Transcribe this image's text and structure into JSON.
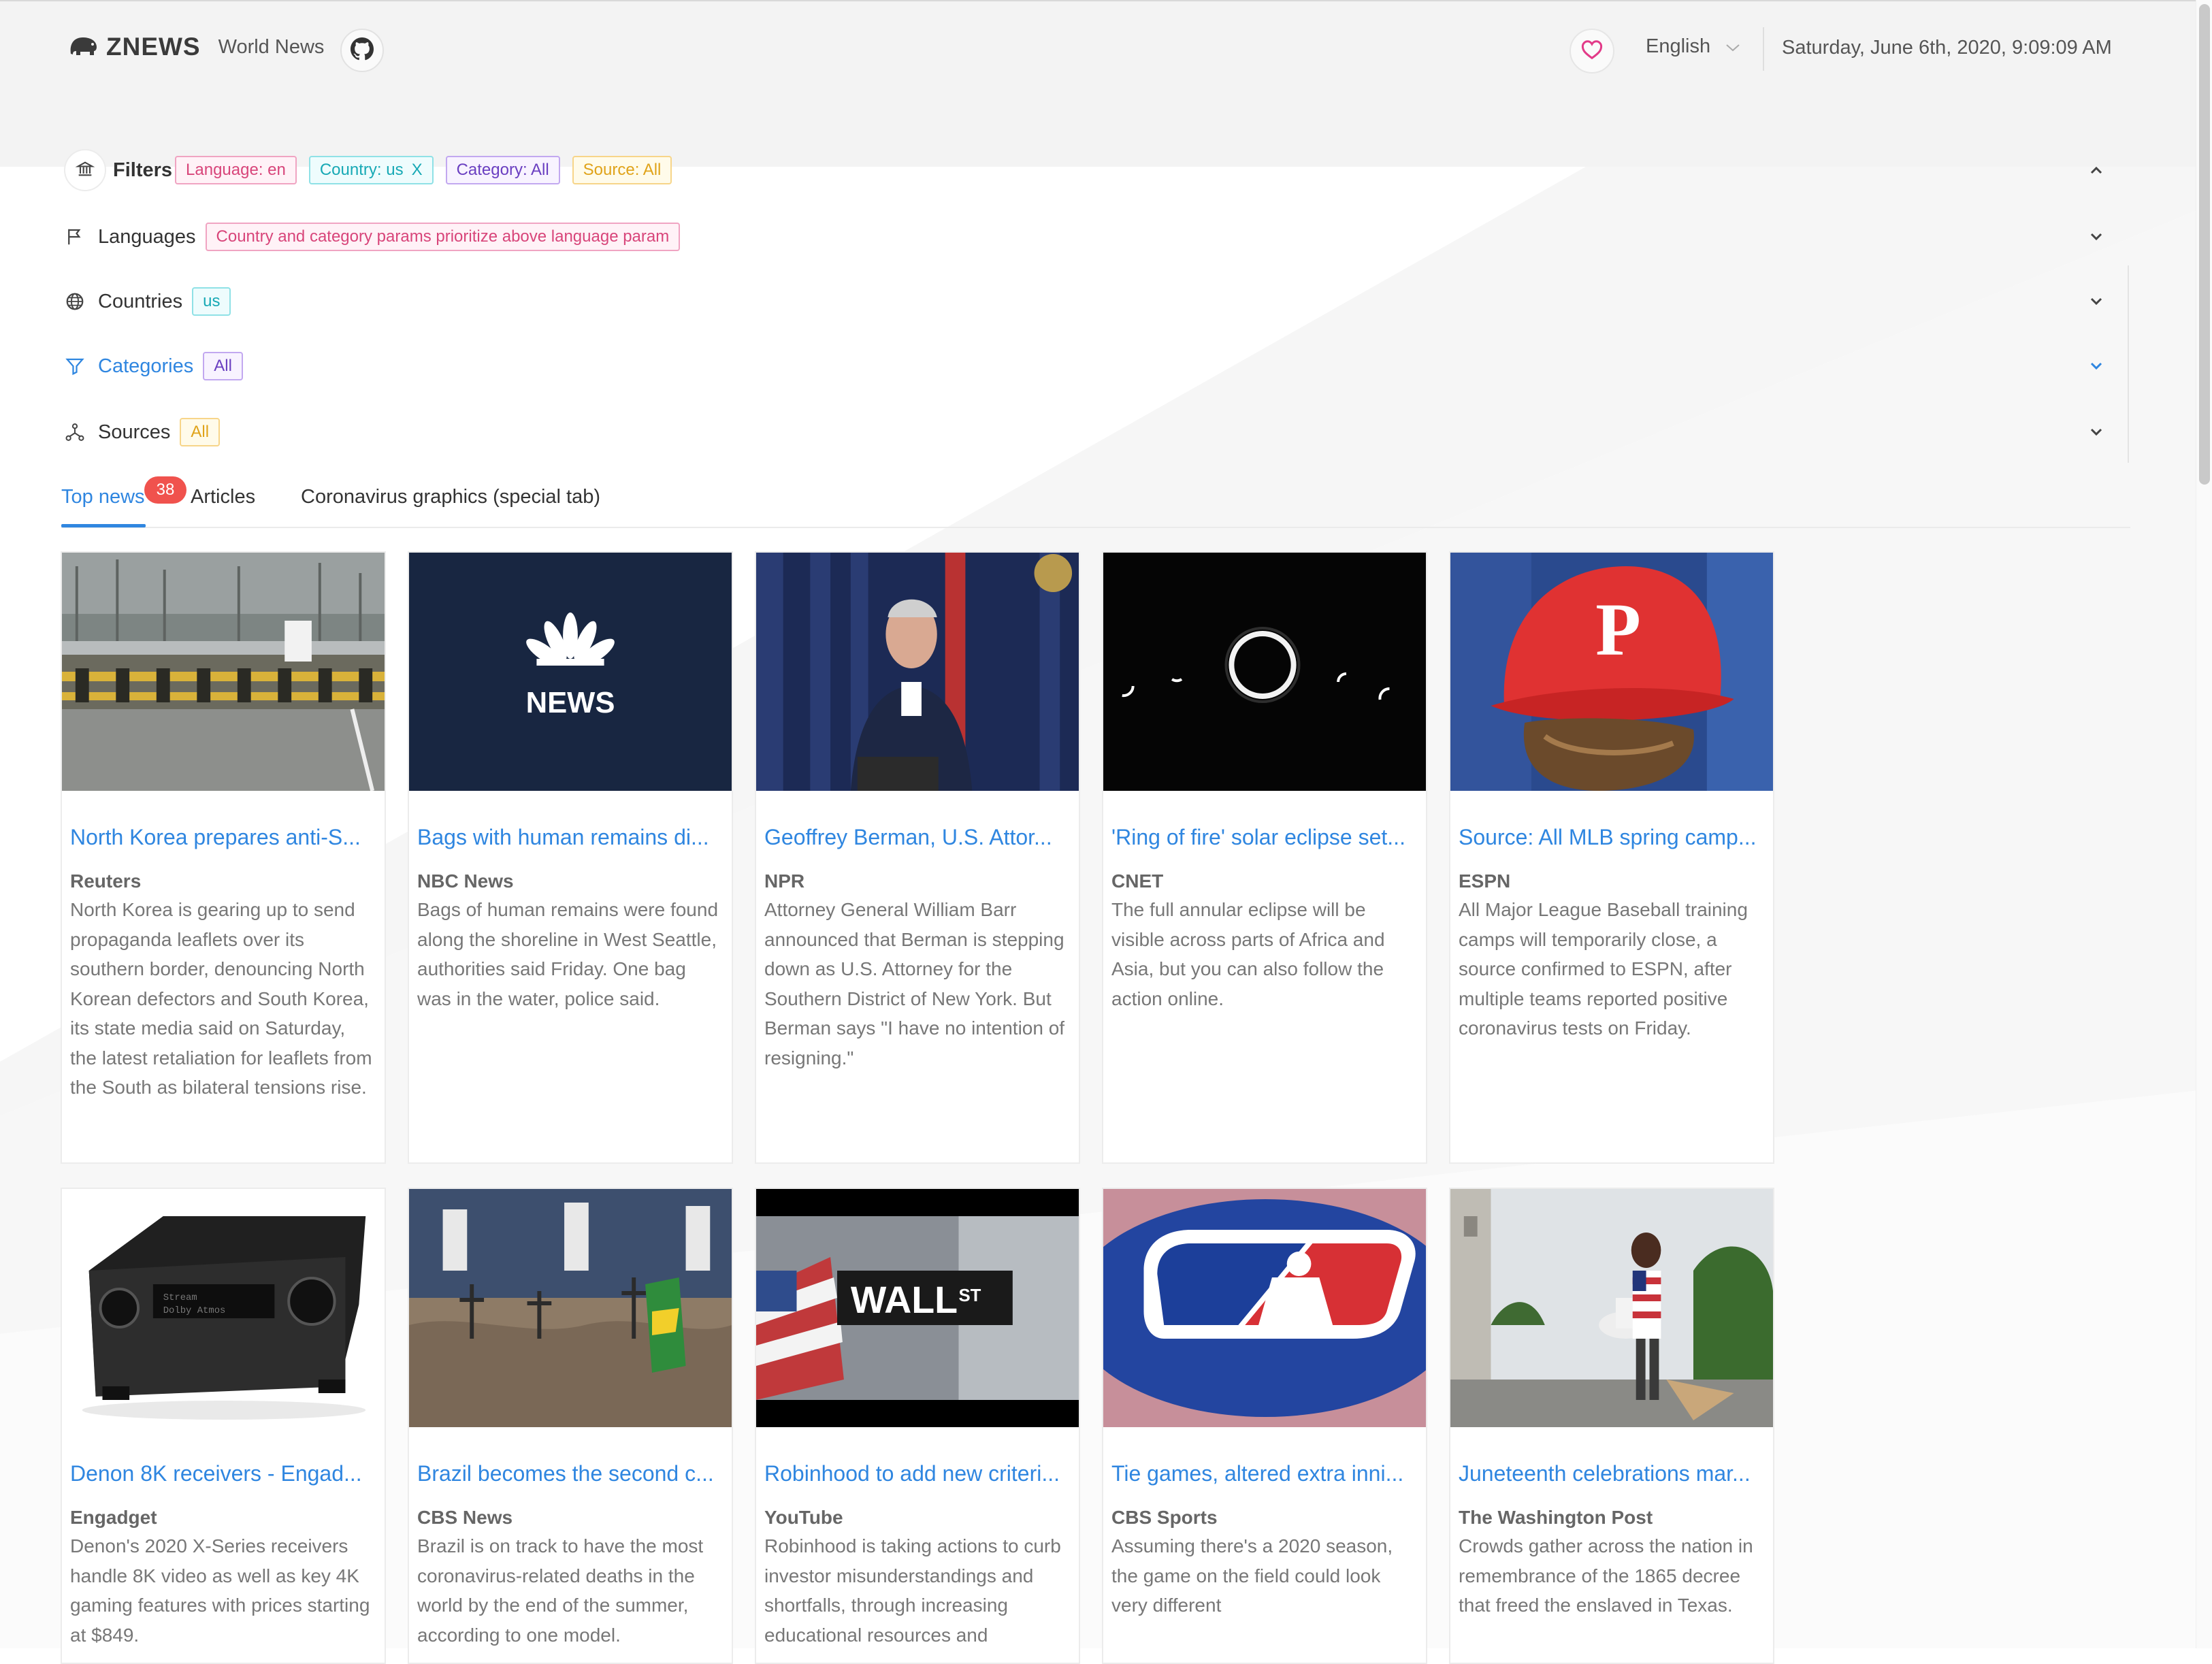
{
  "header": {
    "brand": "ZNEWS",
    "subtitle": "World News",
    "language": "English",
    "datetime": "Saturday, June 6th, 2020, 9:09:09 AM"
  },
  "filters": {
    "title": "Filters",
    "active_tags": [
      {
        "label": "Language: en",
        "color": "#d8457a"
      },
      {
        "label": "Country: us",
        "close": "X",
        "color": "#17a9b5"
      },
      {
        "label": "Category: All",
        "color": "#6a3fc1"
      },
      {
        "label": "Source: All",
        "color": "#e0a31a"
      }
    ],
    "languages": {
      "label": "Languages",
      "note": "Country and category params prioritize above language param"
    },
    "countries": {
      "label": "Countries",
      "tag": "us"
    },
    "categories": {
      "label": "Categories",
      "tag": "All"
    },
    "sources": {
      "label": "Sources",
      "tag": "All"
    }
  },
  "tabs": [
    {
      "label": "Top news",
      "badge": "38",
      "active": true
    },
    {
      "label": "Articles"
    },
    {
      "label": "Coronavirus graphics (special tab)"
    }
  ],
  "cards": [
    {
      "title": "North Korea prepares anti-S...",
      "source": "Reuters",
      "desc": "North Korea is gearing up to send propaganda leaflets over its southern border, denouncing North Korean defectors and South Korea, its state media said on Saturday, the latest retaliation for leaflets from the South as bilateral tensions rise.",
      "image": "border-checkpoint-photo"
    },
    {
      "title": "Bags with human remains di...",
      "source": "NBC News",
      "desc": "Bags of human remains were found along the shoreline in West Seattle, authorities said Friday. One bag was in the water, police said.",
      "image": "nbc-news-logo"
    },
    {
      "title": "Geoffrey Berman, U.S. Attor...",
      "source": "NPR",
      "desc": "Attorney General William Barr announced that Berman is stepping down as U.S. Attorney for the Southern District of New York. But Berman says \"I have no intention of resigning.\"",
      "image": "press-conference-photo"
    },
    {
      "title": "'Ring of fire' solar eclipse set...",
      "source": "CNET",
      "desc": "The full annular eclipse will be visible across parts of Africa and Asia, but you can also follow the action online.",
      "image": "eclipse-photo"
    },
    {
      "title": "Source: All MLB spring camp...",
      "source": "ESPN",
      "desc": "All Major League Baseball training camps will temporarily close, a source confirmed to ESPN, after multiple teams reported positive coronavirus tests on Friday.",
      "image": "phillies-cap-photo"
    },
    {
      "title": "Denon 8K receivers - Engad...",
      "source": "Engadget",
      "desc": "Denon's 2020 X-Series receivers handle 8K video as well as key 4K gaming features with prices starting at $849.",
      "image": "av-receiver-photo"
    },
    {
      "title": "Brazil becomes the second c...",
      "source": "CBS News",
      "desc": "Brazil is on track to have the most coronavirus-related deaths in the world by the end of the summer, according to one model.",
      "image": "brazil-graves-photo"
    },
    {
      "title": "Robinhood to add new criteri...",
      "source": "YouTube",
      "desc": "Robinhood is taking actions to curb investor misunderstandings and shortfalls, through increasing educational resources and",
      "image": "wall-st-sign-photo"
    },
    {
      "title": "Tie games, altered extra inni...",
      "source": "CBS Sports",
      "desc": "Assuming there's a 2020 season, the game on the field could look very different",
      "image": "mlb-logo-field-photo"
    },
    {
      "title": "Juneteenth celebrations mar...",
      "source": "The Washington Post",
      "desc": "Crowds gather across the nation in remembrance of the 1865 decree that freed the enslaved in Texas.",
      "image": "juneteenth-street-photo"
    }
  ],
  "colors": {
    "accent": "#2f86e0",
    "badge": "#f0524d"
  }
}
